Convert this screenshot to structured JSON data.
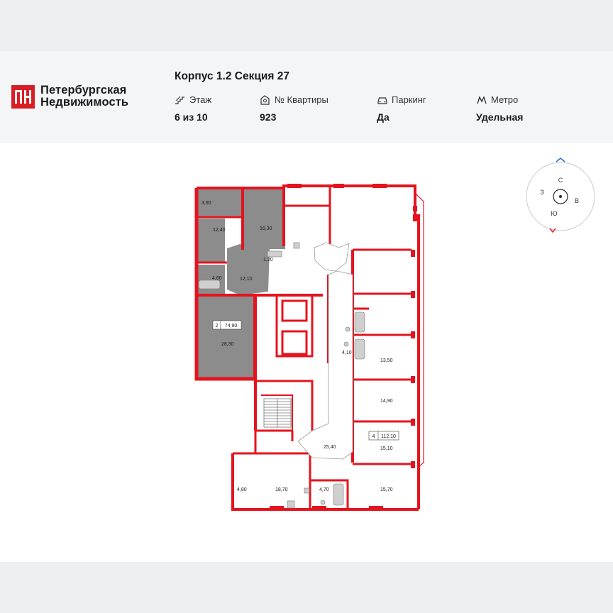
{
  "brand": {
    "name_line1": "Петербургская",
    "name_line2": "Недвижимость",
    "logo_letters": "ПН",
    "color": "#d81e24"
  },
  "header": {
    "title": "Корпус 1.2 Секция 27",
    "info": [
      {
        "label": "Этаж",
        "value": "6 из 10",
        "icon": "stairs-icon"
      },
      {
        "label": "№ Квартиры",
        "value": "923",
        "icon": "key-icon"
      },
      {
        "label": "Паркинг",
        "value": "Да",
        "icon": "car-icon"
      },
      {
        "label": "Метро",
        "value": "Удельная",
        "icon": "metro-icon"
      }
    ]
  },
  "compass": {
    "north": "С",
    "east": "В",
    "south": "Ю",
    "west": "З"
  },
  "plan": {
    "wall_color": "#e4141e",
    "highlight_color": "#8c8c8c",
    "highlighted_apartment": {
      "rooms_badge": "2",
      "area": "74,90"
    },
    "other_apartment": {
      "rooms_badge": "4",
      "area": "112,10"
    },
    "room_labels": [
      "3,90",
      "12,40",
      "16,30",
      "1,20",
      "4,60",
      "12,10",
      "28,30",
      "4,10",
      "13,50",
      "14,90",
      "15,10",
      "25,40",
      "4,80",
      "18,70",
      "4,70",
      "15,70"
    ]
  }
}
